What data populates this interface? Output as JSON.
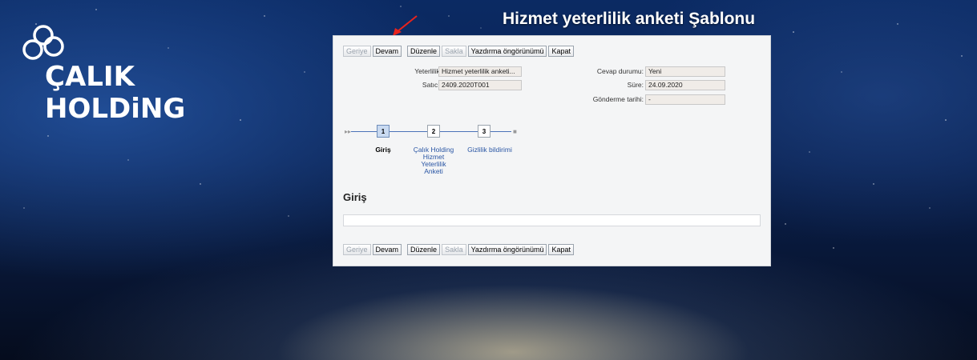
{
  "brand": {
    "name": "ÇALIK HOLDiNG"
  },
  "page": {
    "title": "Hizmet yeterlilik anketi Şablonu"
  },
  "toolbar": {
    "back": "Geriye",
    "continue": "Devam",
    "edit": "Düzenle",
    "save": "Sakla",
    "print_preview": "Yazdırma öngörünümü",
    "close": "Kapat"
  },
  "fields": {
    "qualification_label": "Yeterlilik:",
    "qualification_value": "Hizmet yeterlilik anketi...",
    "vendor_label": "Satıcı:",
    "vendor_value": "2409.2020T001",
    "response_status_label": "Cevap durumu:",
    "response_status_value": "Yeni",
    "duration_label": "Süre:",
    "duration_value": "24.09.2020",
    "sent_date_label": "Gönderme tarihi:",
    "sent_date_value": "-"
  },
  "steps": [
    {
      "number": "1",
      "label": "Giriş",
      "active": true
    },
    {
      "number": "2",
      "label_lines": [
        "Çalık Holding",
        "Hizmet",
        "Yeterlilik",
        "Anketi"
      ],
      "active": false
    },
    {
      "number": "3",
      "label": "Gizlilik bildirimi",
      "active": false
    }
  ],
  "section": {
    "title": "Giriş"
  },
  "colors": {
    "accent": "#2a56a4",
    "arrow": "#e8231c"
  }
}
